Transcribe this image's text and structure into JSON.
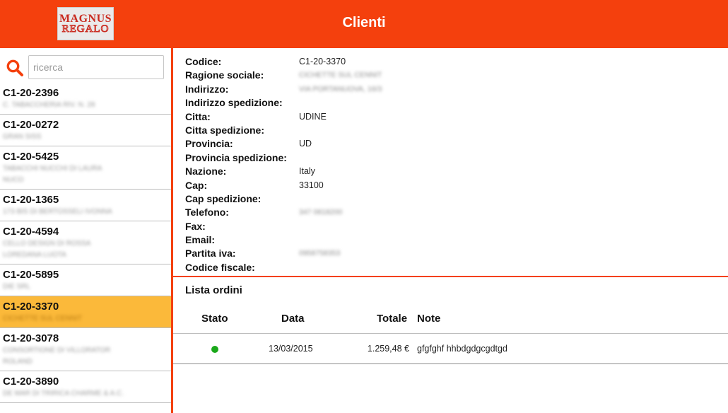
{
  "header": {
    "title": "Clienti",
    "logo_line1": "MAGNUS",
    "logo_line2": "REGALO",
    "background_color": "#f4400d"
  },
  "search": {
    "icon": "search-icon",
    "placeholder": "ricerca",
    "value": ""
  },
  "clients": [
    {
      "code": "C1-20-2396",
      "name_lines": [
        "C. TABACCHERIA RIV. N. 28"
      ],
      "selected": false
    },
    {
      "code": "C1-20-0272",
      "name_lines": [
        "GRAN SISS"
      ],
      "selected": false
    },
    {
      "code": "C1-20-5425",
      "name_lines": [
        "TABACCHI NUCCHI DI LAURA",
        "NUCO"
      ],
      "selected": false
    },
    {
      "code": "C1-20-1365",
      "name_lines": [
        "173 BIS DI BERTOSSELI IVONNA"
      ],
      "selected": false
    },
    {
      "code": "C1-20-4594",
      "name_lines": [
        "CELLO DESIGN DI ROSSA",
        "LOREDANA LUOTA"
      ],
      "selected": false
    },
    {
      "code": "C1-20-5895",
      "name_lines": [
        "DIE SRL"
      ],
      "selected": false
    },
    {
      "code": "C1-20-3370",
      "name_lines": [
        "CICHETTE SUL CENNIT"
      ],
      "selected": true
    },
    {
      "code": "C1-20-3078",
      "name_lines": [
        "CONSORTIONE DI VILLORATOR",
        "ROLAND"
      ],
      "selected": false
    },
    {
      "code": "C1-20-3890",
      "name_lines": [
        "DE MAR DI TRIRICA CHARME & A.C."
      ],
      "selected": false
    }
  ],
  "client_detail": {
    "fields": [
      {
        "label": "Codice:",
        "value": "C1-20-3370",
        "blurred": false
      },
      {
        "label": "Ragione sociale:",
        "value": "CICHETTE SUL CENNIT",
        "blurred": true
      },
      {
        "label": "Indirizzo:",
        "value": "VIA PORTANUOVA, 16/3",
        "blurred": true
      },
      {
        "label": "Indirizzo spedizione:",
        "value": "",
        "blurred": false
      },
      {
        "label": "Citta:",
        "value": "UDINE",
        "blurred": false
      },
      {
        "label": "Citta spedizione:",
        "value": "",
        "blurred": false
      },
      {
        "label": "Provincia:",
        "value": "UD",
        "blurred": false
      },
      {
        "label": "Provincia spedizione:",
        "value": "",
        "blurred": false
      },
      {
        "label": "Nazione:",
        "value": "Italy",
        "blurred": false
      },
      {
        "label": "Cap:",
        "value": "33100",
        "blurred": false
      },
      {
        "label": "Cap spedizione:",
        "value": "",
        "blurred": false
      },
      {
        "label": "Telefono:",
        "value": "347 0818200",
        "blurred": true
      },
      {
        "label": "Fax:",
        "value": "",
        "blurred": false
      },
      {
        "label": "Email:",
        "value": "",
        "blurred": false
      },
      {
        "label": "Partita iva:",
        "value": "0958758353",
        "blurred": true
      },
      {
        "label": "Codice fiscale:",
        "value": "",
        "blurred": false
      }
    ]
  },
  "orders": {
    "title": "Lista ordini",
    "columns": {
      "stato": "Stato",
      "data": "Data",
      "totale": "Totale",
      "note": "Note"
    },
    "rows": [
      {
        "status_color": "#1aa81a",
        "date": "13/03/2015",
        "total": "1.259,48 €",
        "note": "gfgfghf hhbdgdgcgdtgd"
      }
    ]
  }
}
